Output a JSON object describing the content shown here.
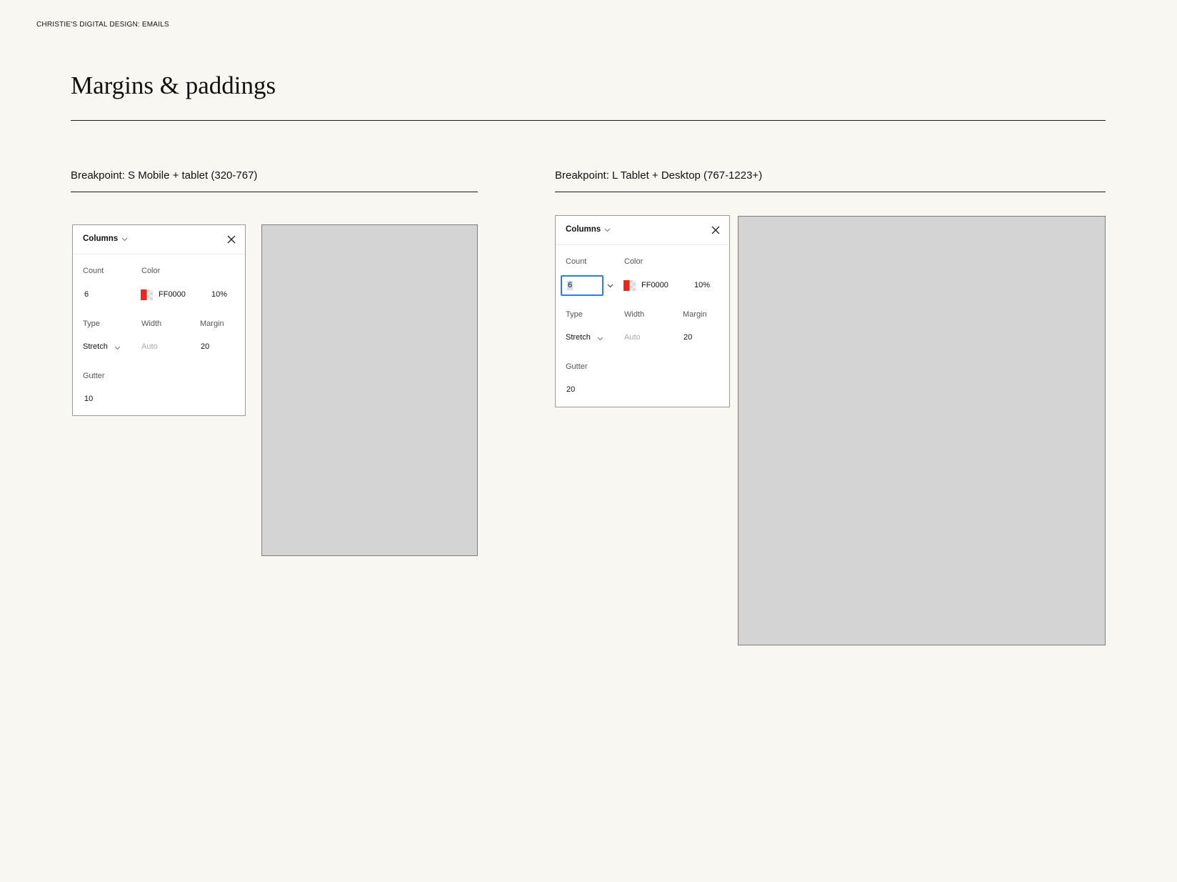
{
  "document": {
    "label": "CHRISTIE'S DIGITAL DESIGN: EMAILS",
    "title": "Margins & paddings"
  },
  "breakpoints": [
    {
      "heading": "Breakpoint: S Mobile + tablet (320-767)",
      "panel": {
        "title": "Columns",
        "count_label": "Count",
        "count_value": "6",
        "color_label": "Color",
        "color_hex": "FF0000",
        "opacity": "10%",
        "type_label": "Type",
        "type_value": "Stretch",
        "width_label": "Width",
        "width_placeholder": "Auto",
        "margin_label": "Margin",
        "margin_value": "20",
        "gutter_label": "Gutter",
        "gutter_value": "10"
      }
    },
    {
      "heading": "Breakpoint: L Tablet + Desktop (767-1223+)",
      "panel": {
        "title": "Columns",
        "count_label": "Count",
        "count_value": "6",
        "color_label": "Color",
        "color_hex": "FF0000",
        "opacity": "10%",
        "type_label": "Type",
        "type_value": "Stretch",
        "width_label": "Width",
        "width_placeholder": "Auto",
        "margin_label": "Margin",
        "margin_value": "20",
        "gutter_label": "Gutter",
        "gutter_value": "20"
      }
    }
  ],
  "colors": {
    "swatch": "#e8281c",
    "background": "#f8f7f2",
    "artboard": "#d4d4d4",
    "focus": "#2c7fde"
  }
}
